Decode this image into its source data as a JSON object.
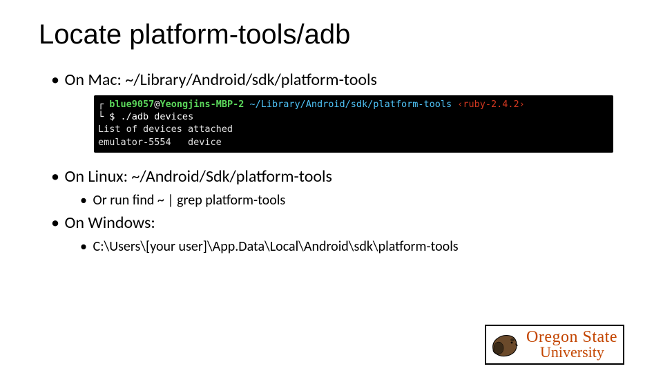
{
  "title": "Locate platform-tools/adb",
  "bullets": {
    "mac": "On Mac: ~/Library/Android/sdk/platform-tools",
    "linux": "On Linux: ~/Android/Sdk/platform-tools",
    "linux_sub": "Or run find ~ | grep platform-tools",
    "windows": "On Windows:",
    "windows_sub": "C:\\Users\\[your user]\\App.Data\\Local\\Android\\sdk\\platform-tools"
  },
  "terminal": {
    "user": "blue9057",
    "at": "@",
    "host": "Yeongjins-MBP-2",
    "path": "~/Library/Android/sdk/platform-tools",
    "ruby_open": "‹",
    "ruby": "ruby-2.4.2",
    "ruby_close": "›",
    "prompt": "$ ",
    "cmd": "./adb devices",
    "out1": "List of devices attached",
    "out2": "emulator-5554   device"
  },
  "logo": {
    "line1": "Oregon State",
    "line2": "University"
  }
}
